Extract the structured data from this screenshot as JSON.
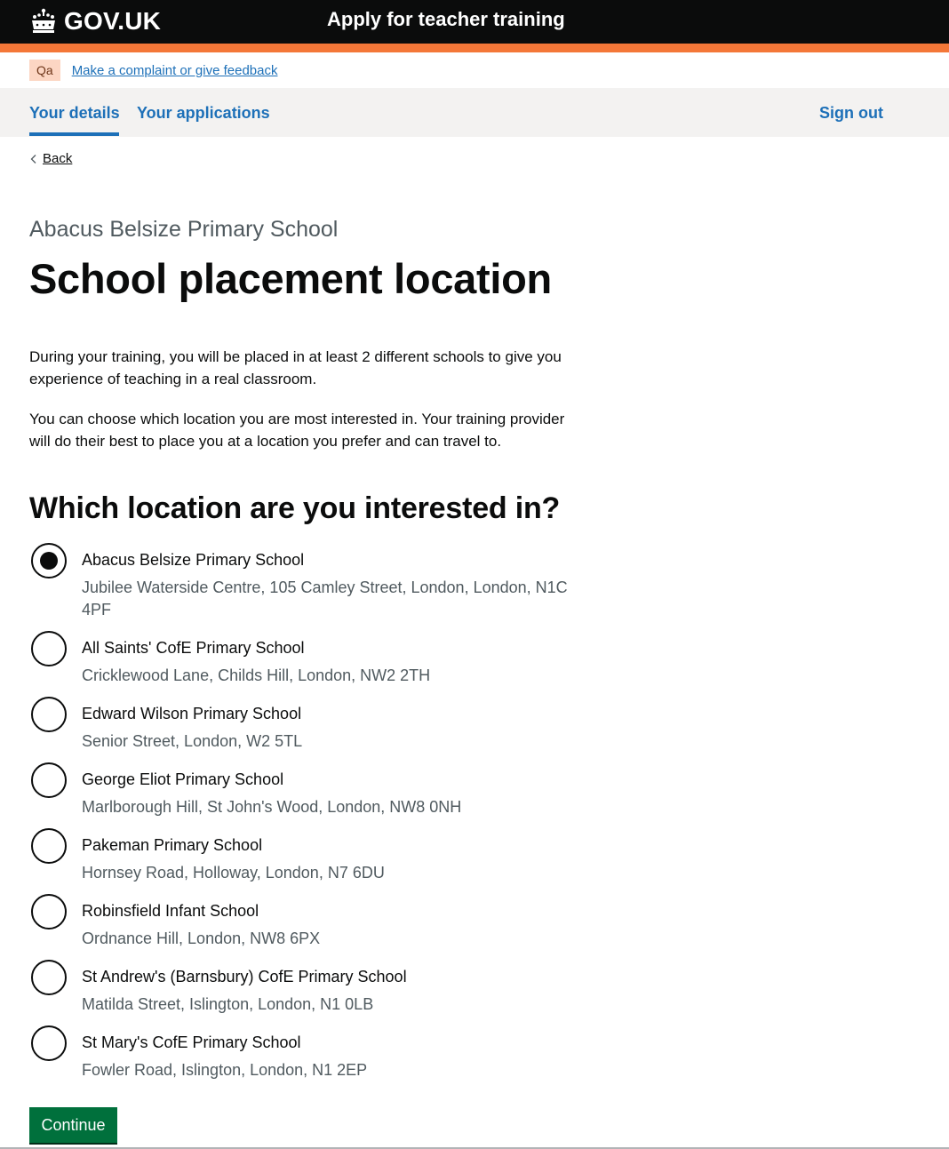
{
  "header": {
    "logo_text": "GOV.UK",
    "service_name": "Apply for teacher training"
  },
  "phase_banner": {
    "tag": "Qa",
    "link": "Make a complaint or give feedback"
  },
  "nav": {
    "items": [
      {
        "label": "Your details",
        "active": true
      },
      {
        "label": "Your applications",
        "active": false
      }
    ],
    "sign_out": "Sign out"
  },
  "back_link": "Back",
  "caption": "Abacus Belsize Primary School",
  "title": "School placement location",
  "paragraphs": [
    "During your training, you will be placed in at least 2 different schools to give you experience of teaching in a real classroom.",
    "You can choose which location you are most interested in. Your training provider will do their best to place you at a location you prefer and can travel to."
  ],
  "question": "Which location are you interested in?",
  "options": [
    {
      "label": "Abacus Belsize Primary School",
      "hint": "Jubilee Waterside Centre, 105 Camley Street, London, London, N1C 4PF",
      "checked": true
    },
    {
      "label": "All Saints' CofE Primary School",
      "hint": "Cricklewood Lane, Childs Hill, London, NW2 2TH",
      "checked": false
    },
    {
      "label": "Edward Wilson Primary School",
      "hint": "Senior Street, London, W2 5TL",
      "checked": false
    },
    {
      "label": "George Eliot Primary School",
      "hint": "Marlborough Hill, St John's Wood, London, NW8 0NH",
      "checked": false
    },
    {
      "label": "Pakeman Primary School",
      "hint": "Hornsey Road, Holloway, London, N7 6DU",
      "checked": false
    },
    {
      "label": "Robinsfield Infant School",
      "hint": "Ordnance Hill, London, NW8 6PX",
      "checked": false
    },
    {
      "label": "St Andrew's (Barnsbury) CofE Primary School",
      "hint": "Matilda Street, Islington, London, N1 0LB",
      "checked": false
    },
    {
      "label": "St Mary's CofE Primary School",
      "hint": "Fowler Road, Islington, London, N1 2EP",
      "checked": false
    }
  ],
  "continue_label": "Continue",
  "colors": {
    "brand_black": "#0b0c0c",
    "accent_orange": "#f47738",
    "link_blue": "#1d70b8",
    "button_green": "#00703c",
    "hint_grey": "#505a5f"
  }
}
